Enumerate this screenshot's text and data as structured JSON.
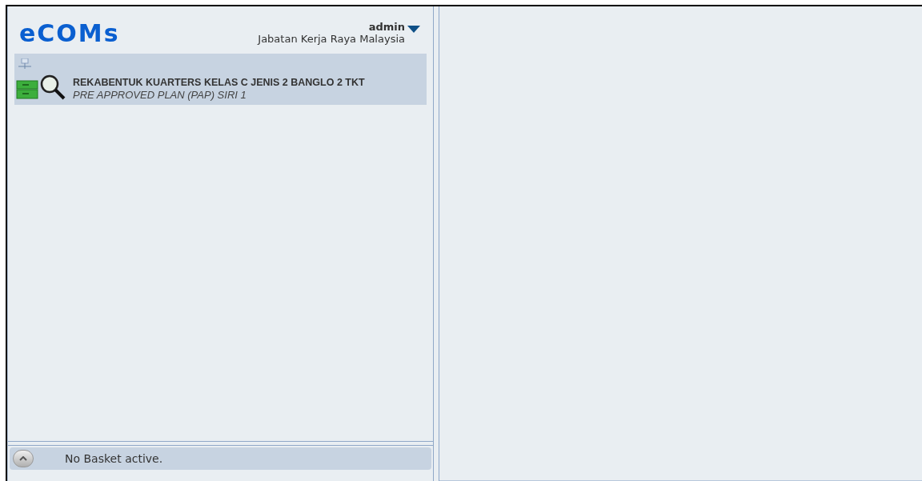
{
  "header": {
    "logo": "eCOMs",
    "user": "admin",
    "organization": "Jabatan Kerja Raya Malaysia"
  },
  "projects": [
    {
      "title": "REKABENTUK KUARTERS KELAS C JENIS 2 BANGLO 2 TKT",
      "subtitle": "PRE APPROVED PLAN (PAP) SIRI 1",
      "selected": true
    }
  ],
  "basket_bar": {
    "status": "No Basket active."
  }
}
